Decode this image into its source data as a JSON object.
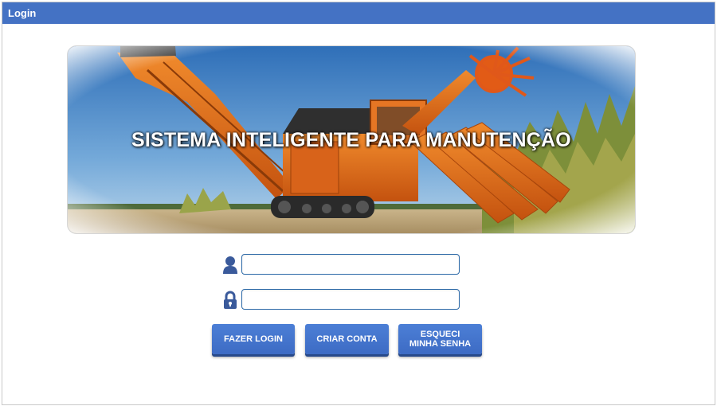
{
  "window": {
    "title": "Login"
  },
  "banner": {
    "title": "SISTEMA INTELIGENTE PARA MANUTENÇÃO",
    "image": "sugarcane-harvester-photo"
  },
  "form": {
    "username": {
      "icon": "user-icon",
      "value": "",
      "placeholder": ""
    },
    "password": {
      "icon": "lock-icon",
      "value": "",
      "placeholder": ""
    }
  },
  "buttons": {
    "login": "FAZER LOGIN",
    "create_account": "CRIAR CONTA",
    "forgot_line1": "ESQUECI",
    "forgot_line2": "MINHA SENHA"
  },
  "colors": {
    "titlebar": "#4472c4",
    "button": "#4472c4",
    "input_border": "#2e6aa8",
    "icon": "#3a5a9b",
    "machine": "#e06a1a"
  }
}
